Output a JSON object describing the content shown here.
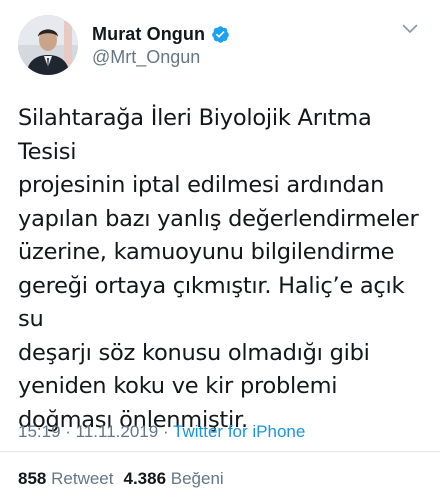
{
  "user": {
    "display_name": "Murat Ongun",
    "handle": "@Mrt_Ongun",
    "verified_icon": "verified-badge-icon",
    "avatar_icon": "profile-avatar"
  },
  "menu": {
    "icon": "chevron-down-icon"
  },
  "tweet": {
    "text": "Silahtarağa İleri Biyolojik Arıtma Tesisi\nprojesinin iptal edilmesi ardından\nyapılan bazı yanlış değerlendirmeler\nüzerine, kamuoyunu bilgilendirme\ngereği ortaya çıkmıştır. Haliç’e açık su\ndeşarjı söz konusu olmadığı gibi\nyeniden koku ve kir problemi\ndoğması önlenmiştir.",
    "time": "15:19",
    "separator": " · ",
    "date": "11.11.2019",
    "source": "Twitter for iPhone"
  },
  "stats": {
    "retweet_count": "858",
    "retweet_label": "Retweet",
    "like_count": "4.386",
    "like_label": "Beğeni"
  },
  "colors": {
    "text": "#14171a",
    "secondary": "#657786",
    "link": "#1b95e0",
    "verified": "#1da1f2",
    "divider": "#e1e8ed"
  }
}
